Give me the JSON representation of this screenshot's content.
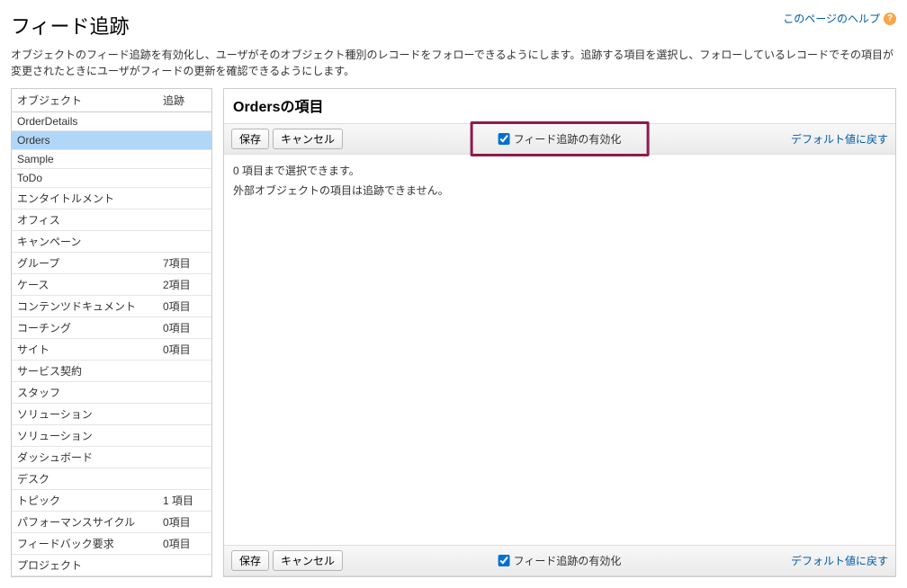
{
  "page": {
    "title": "フィード追跡",
    "help_link": "このページのヘルプ",
    "description": "オブジェクトのフィード追跡を有効化し、ユーザがそのオブジェクト種別のレコードをフォローできるようにします。追跡する項目を選択し、フォローしているレコードでその項目が変更されたときにユーザがフィードの更新を確認できるようにします。"
  },
  "sidebar": {
    "col_object": "オブジェクト",
    "col_tracking": "追跡",
    "items": [
      {
        "label": "OrderDetails",
        "tracking": "",
        "selected": false
      },
      {
        "label": "Orders",
        "tracking": "",
        "selected": true
      },
      {
        "label": "Sample",
        "tracking": "",
        "selected": false
      },
      {
        "label": "ToDo",
        "tracking": "",
        "selected": false
      },
      {
        "label": "エンタイトルメント",
        "tracking": "",
        "selected": false
      },
      {
        "label": "オフィス",
        "tracking": "",
        "selected": false
      },
      {
        "label": "キャンペーン",
        "tracking": "",
        "selected": false
      },
      {
        "label": "グループ",
        "tracking": "7項目",
        "selected": false
      },
      {
        "label": "ケース",
        "tracking": "2項目",
        "selected": false
      },
      {
        "label": "コンテンツドキュメント",
        "tracking": "0項目",
        "selected": false
      },
      {
        "label": "コーチング",
        "tracking": "0項目",
        "selected": false
      },
      {
        "label": "サイト",
        "tracking": "0項目",
        "selected": false
      },
      {
        "label": "サービス契約",
        "tracking": "",
        "selected": false
      },
      {
        "label": "スタッフ",
        "tracking": "",
        "selected": false
      },
      {
        "label": "ソリューション",
        "tracking": "",
        "selected": false
      },
      {
        "label": "ソリューション",
        "tracking": "",
        "selected": false
      },
      {
        "label": "ダッシュボード",
        "tracking": "",
        "selected": false
      },
      {
        "label": "デスク",
        "tracking": "",
        "selected": false
      },
      {
        "label": "トピック",
        "tracking": "1 項目",
        "selected": false
      },
      {
        "label": "パフォーマンスサイクル",
        "tracking": "0項目",
        "selected": false
      },
      {
        "label": "フィードバック要求",
        "tracking": "0項目",
        "selected": false
      },
      {
        "label": "プロジェクト",
        "tracking": "",
        "selected": false
      }
    ]
  },
  "main": {
    "title": "Ordersの項目",
    "toolbar": {
      "save": "保存",
      "cancel": "キャンセル",
      "enable_checkbox": "フィード追跡の有効化",
      "reset": "デフォルト値に戻す"
    },
    "body": {
      "line1": "0 項目まで選択できます。",
      "line2": "外部オブジェクトの項目は追跡できません。"
    }
  }
}
